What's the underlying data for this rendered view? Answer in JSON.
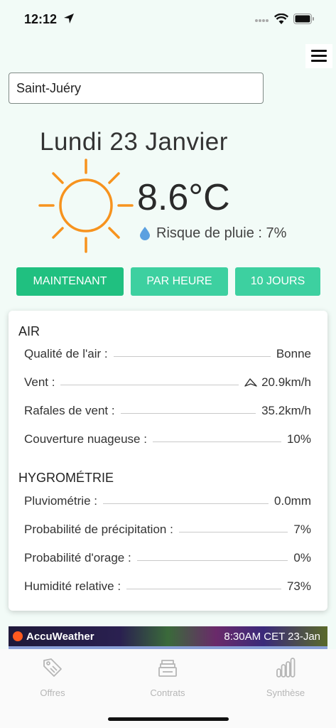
{
  "status": {
    "time": "12:12"
  },
  "search": {
    "value": "Saint-Juéry"
  },
  "weather": {
    "date": "Lundi 23 Janvier",
    "temperature": "8.6°C",
    "rain_risk": "Risque de pluie : 7%"
  },
  "tabs": [
    {
      "label": "MAINTENANT",
      "active": true
    },
    {
      "label": "PAR HEURE",
      "active": false
    },
    {
      "label": "10 JOURS",
      "active": false
    }
  ],
  "air": {
    "title": "AIR",
    "rows": [
      {
        "label": "Qualité de l'air :",
        "value": "Bonne"
      },
      {
        "label": "Vent :",
        "value": "20.9km/h"
      },
      {
        "label": "Rafales de vent :",
        "value": "35.2km/h"
      },
      {
        "label": "Couverture nuageuse :",
        "value": "10%"
      }
    ]
  },
  "hygro": {
    "title": "HYGROMÉTRIE",
    "rows": [
      {
        "label": "Pluviométrie :",
        "value": "0.0mm"
      },
      {
        "label": "Probabilité de précipitation :",
        "value": "7%"
      },
      {
        "label": "Probabilité d'orage :",
        "value": "0%"
      },
      {
        "label": "Humidité relative :",
        "value": "73%"
      }
    ]
  },
  "banner": {
    "brand": "AccuWeather",
    "time": "8:30AM CET 23-Jan"
  },
  "nav": [
    {
      "label": "Offres",
      "icon": "tag-icon"
    },
    {
      "label": "Contrats",
      "icon": "documents-stack-icon"
    },
    {
      "label": "Synthèse",
      "icon": "bar-chart-icon"
    }
  ],
  "colors": {
    "background": "#f2fbf7",
    "tab_active": "#20c080",
    "tab_inactive": "#3dd0a0",
    "sun": "#f7931e",
    "rain_drop": "#5ba0e0"
  }
}
